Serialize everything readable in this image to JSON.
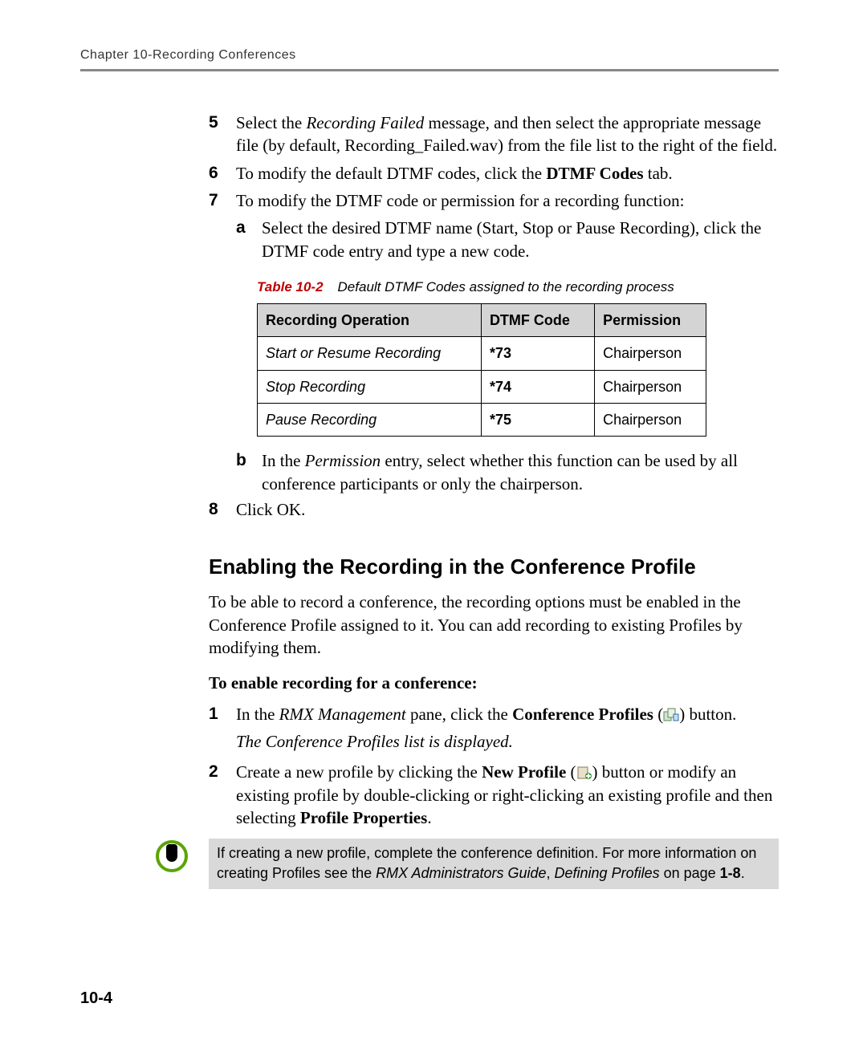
{
  "header": {
    "running": "Chapter 10-Recording Conferences"
  },
  "steps": {
    "s5": {
      "num": "5",
      "pre": "Select the ",
      "em": "Recording Failed",
      "post": " message, and then select the appropriate message file (by default, Recording_Failed.wav) from the file list to the right of the field."
    },
    "s6": {
      "num": "6",
      "pre": "To modify the default DTMF codes, click the ",
      "bold": "DTMF Codes",
      "post": " tab."
    },
    "s7": {
      "num": "7",
      "text": "To modify the DTMF code or permission for a recording function:"
    },
    "s7a": {
      "num": "a",
      "text": "Select the desired DTMF name (Start, Stop or Pause Recording), click the DTMF code entry and type a new code."
    },
    "s7b": {
      "num": "b",
      "pre": "In the ",
      "em": "Permission",
      "post": " entry, select whether this function can be used by all conference participants or only the chairperson."
    },
    "s8": {
      "num": "8",
      "text": "Click OK."
    }
  },
  "table": {
    "label": "Table 10-2",
    "caption": "Default DTMF Codes assigned to the recording process",
    "headers": {
      "op": "Recording Operation",
      "code": "DTMF Code",
      "perm": "Permission"
    },
    "rows": [
      {
        "op": "Start or Resume Recording",
        "code": "*73",
        "perm": "Chairperson"
      },
      {
        "op": "Stop Recording",
        "code": "*74",
        "perm": "Chairperson"
      },
      {
        "op": "Pause Recording",
        "code": "*75",
        "perm": "Chairperson"
      }
    ]
  },
  "section": {
    "title": "Enabling the Recording in the Conference Profile",
    "intro": "To be able to record a conference, the recording options must be enabled in the Conference Profile assigned to it. You can add recording to existing Profiles by modifying them.",
    "sub": "To enable recording for a conference:"
  },
  "steps2": {
    "s1": {
      "num": "1",
      "a": "In the ",
      "em": "RMX Management",
      "b": " pane, click the ",
      "bold": "Conference Profiles",
      "c": " (",
      "d": ") button."
    },
    "s1_display": "The Conference Profiles list is displayed.",
    "s2": {
      "num": "2",
      "a": "Create a new profile by clicking the ",
      "bold1": "New Profile",
      "b": " (",
      "c": ") button or modify an existing profile by double-clicking or right-clicking an existing profile and then selecting ",
      "bold2": "Profile Properties",
      "d": "."
    }
  },
  "note": {
    "a": "If creating a new profile, complete the conference definition. For more information on creating Profiles see the ",
    "em": "RMX Administrators Guide",
    "b": ", ",
    "em2": "Defining Profiles",
    "c": " on page ",
    "bold": "1-8",
    "d": "."
  },
  "page_num": "10-4"
}
